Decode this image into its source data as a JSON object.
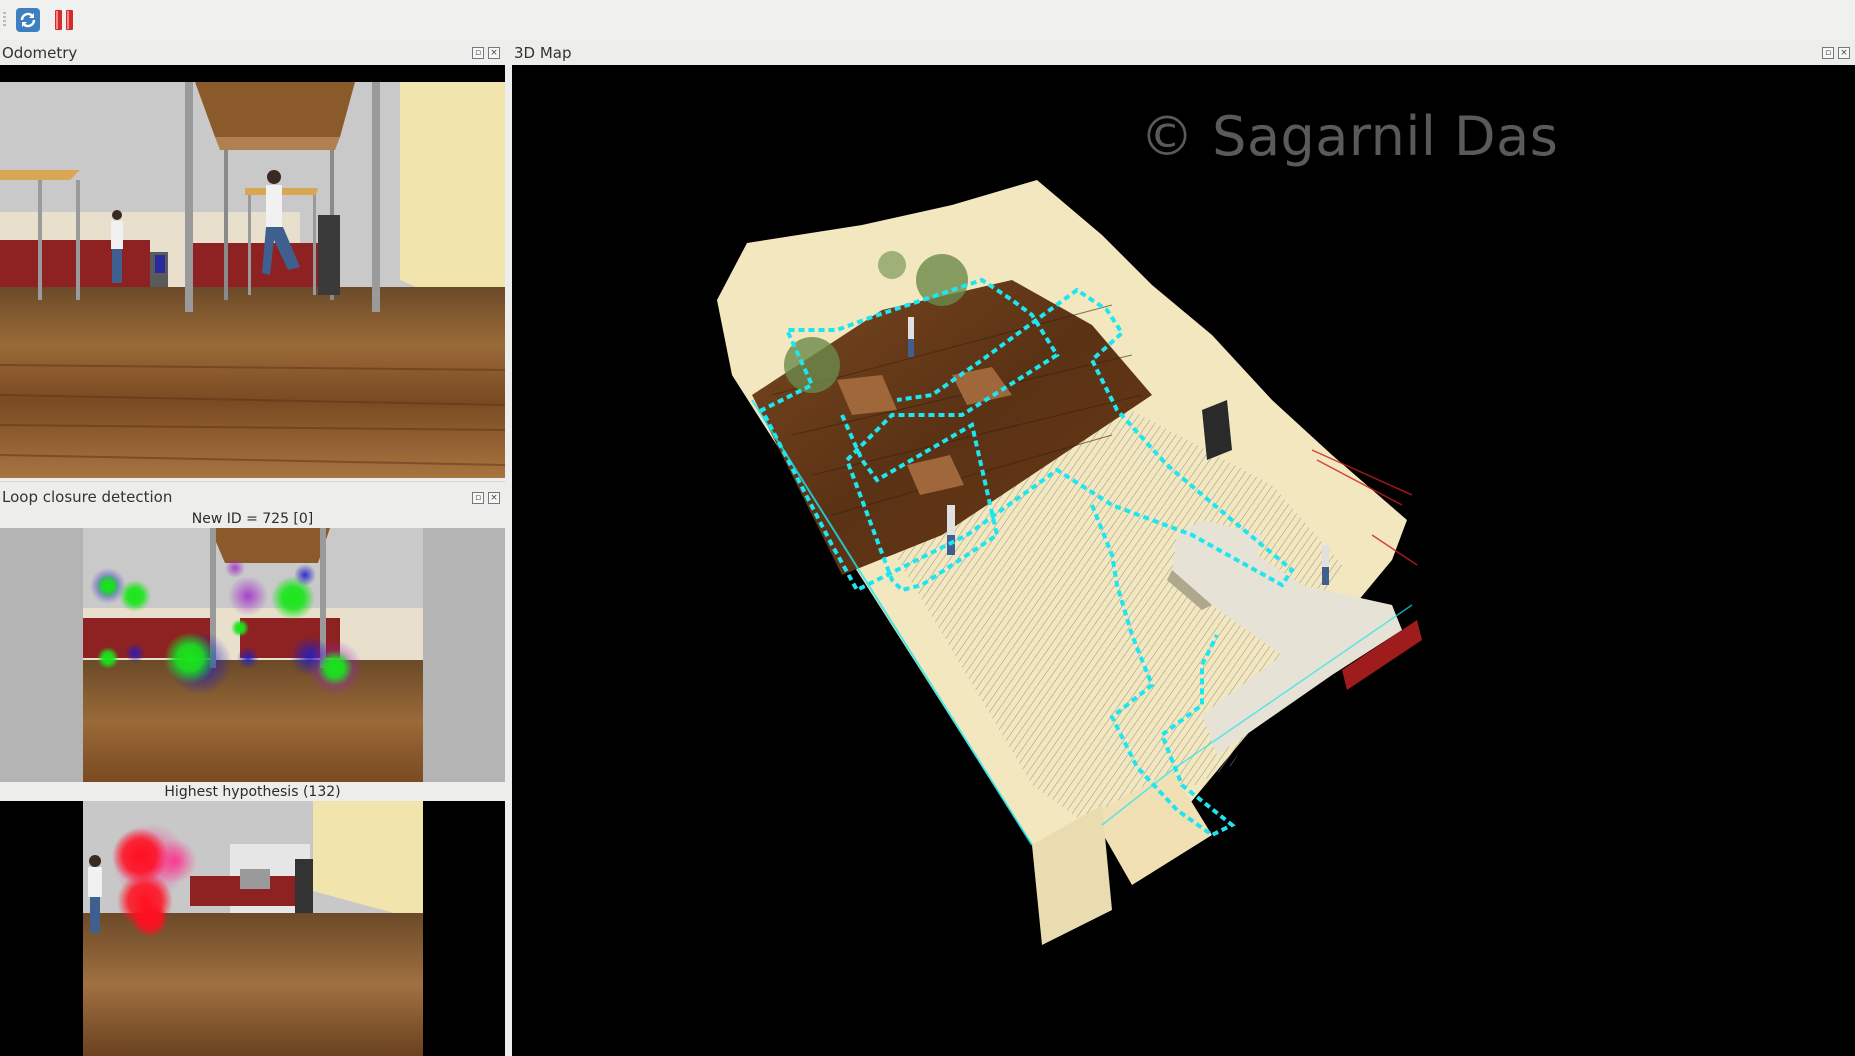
{
  "toolbar": {
    "refresh_icon": "refresh-icon",
    "pause_icon": "pause-icon"
  },
  "odometry": {
    "title": "Odometry"
  },
  "loop_closure": {
    "title": "Loop closure detection",
    "new_id_caption": "New ID = 725 [0]",
    "hypothesis_caption": "Highest hypothesis (132)"
  },
  "map3d": {
    "title": "3D Map",
    "watermark": "© Sagarnil Das"
  },
  "colors": {
    "trajectory": "#1ee6f0",
    "floor": "#6b3a1c",
    "wall": "#f3e7bf",
    "feature_green": "#19e619",
    "feature_blue": "#1c1cc8",
    "feature_red": "#ff1020"
  }
}
